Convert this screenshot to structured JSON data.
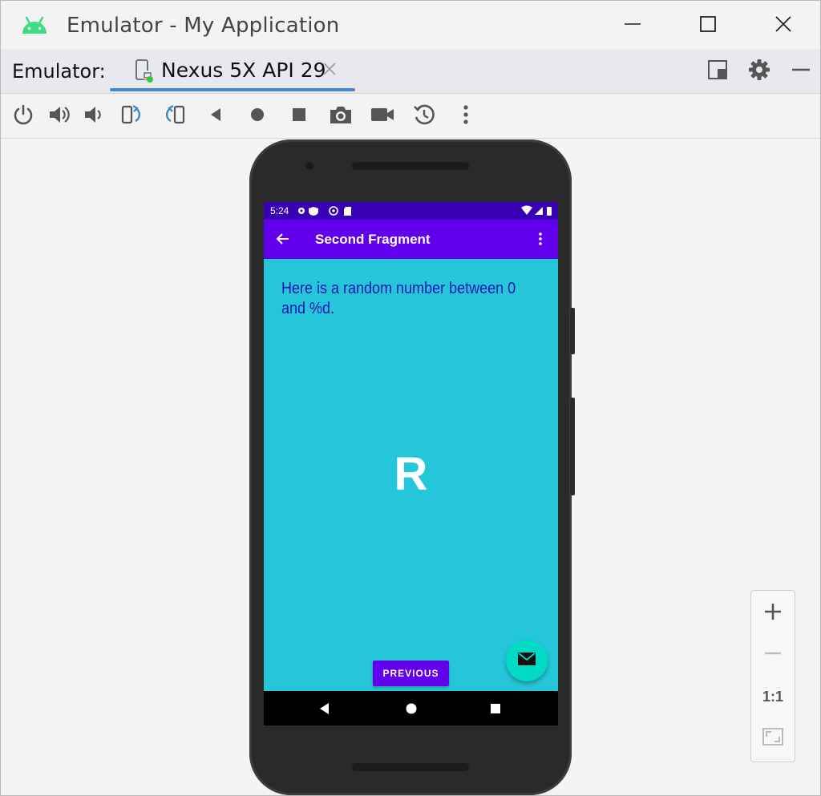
{
  "window": {
    "title": "Emulator - My Application",
    "controls": {
      "minimize": "minimize-icon",
      "maximize": "maximize-icon",
      "close": "close-icon"
    }
  },
  "tabbar": {
    "label": "Emulator:",
    "tab": {
      "title": "Nexus 5X API 29",
      "icon": "phone-device-icon",
      "close": "close-icon"
    },
    "tools": [
      "window-mode-icon",
      "gear-icon",
      "hide-icon"
    ]
  },
  "toolbar": {
    "buttons": [
      "power-icon",
      "volume-up-icon",
      "volume-down-icon",
      "rotate-left-icon",
      "rotate-right-icon",
      "back-icon",
      "home-icon",
      "overview-icon",
      "screenshot-camera-icon",
      "screen-record-icon",
      "snapshot-icon",
      "more-icon"
    ]
  },
  "device": {
    "status_bar": {
      "time": "5:24"
    },
    "app_bar": {
      "title": "Second Fragment"
    },
    "content": {
      "message": "Here is a random number between 0 and %d.",
      "random_value": "R",
      "previous_button": "PREVIOUS"
    }
  },
  "zoom": {
    "zoom_in": "+",
    "zoom_out": "−",
    "actual_size": "1:1",
    "fit": "fit-screen-icon"
  },
  "colors": {
    "status_bar": "#3700b3",
    "app_bar": "#6200ee",
    "background": "#26c6da",
    "fab": "#03dac5",
    "text": "#1a16b5",
    "tab_underline": "#4a86c8"
  }
}
